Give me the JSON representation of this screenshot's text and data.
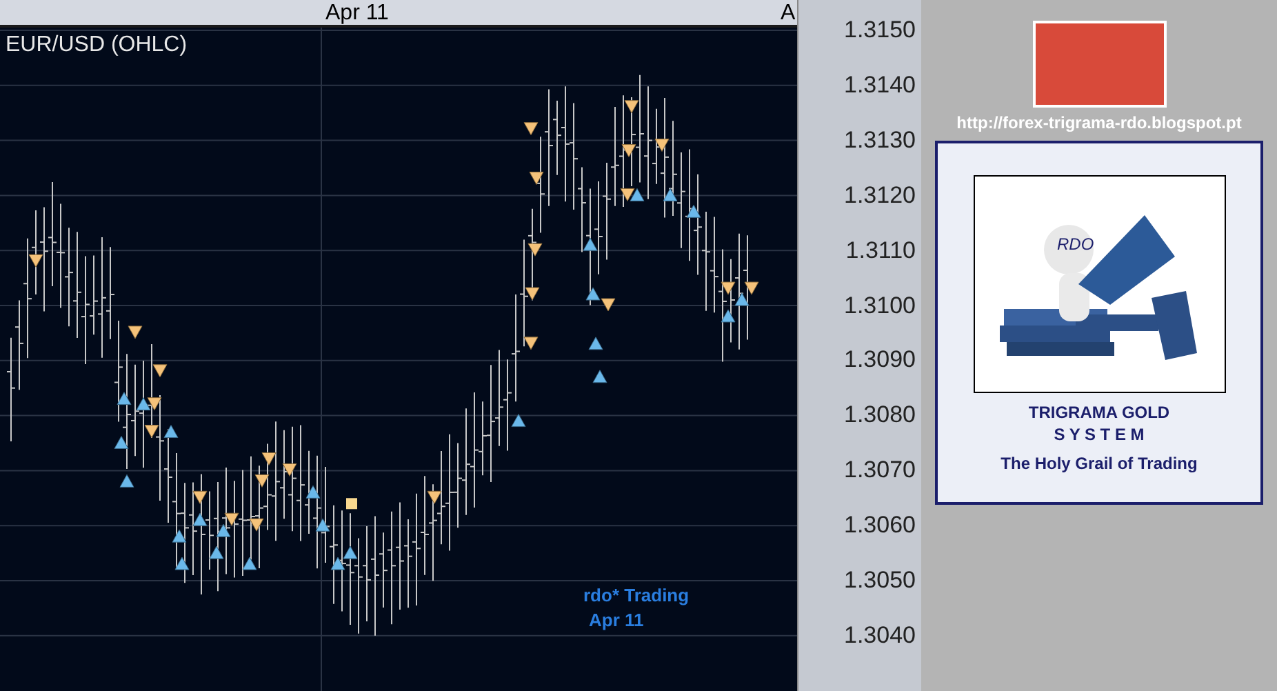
{
  "chart": {
    "title": "EUR/USD (OHLC)",
    "date_labels": [
      "Apr 11",
      "A"
    ],
    "price_labels": [
      "1.3150",
      "1.3140",
      "1.3130",
      "1.3120",
      "1.3110",
      "1.3100",
      "1.3090",
      "1.3080",
      "1.3070",
      "1.3060",
      "1.3050",
      "1.3040"
    ],
    "watermark_lines": [
      "rdo* Trading",
      "Apr 11"
    ]
  },
  "sidebar": {
    "url": "http://forex-trigrama-rdo.blogspot.pt",
    "card": {
      "image_label": "RDO",
      "lines": [
        "TRIGRAMA GOLD",
        "S Y S T E M",
        "The Holy Grail of Trading"
      ]
    }
  }
}
